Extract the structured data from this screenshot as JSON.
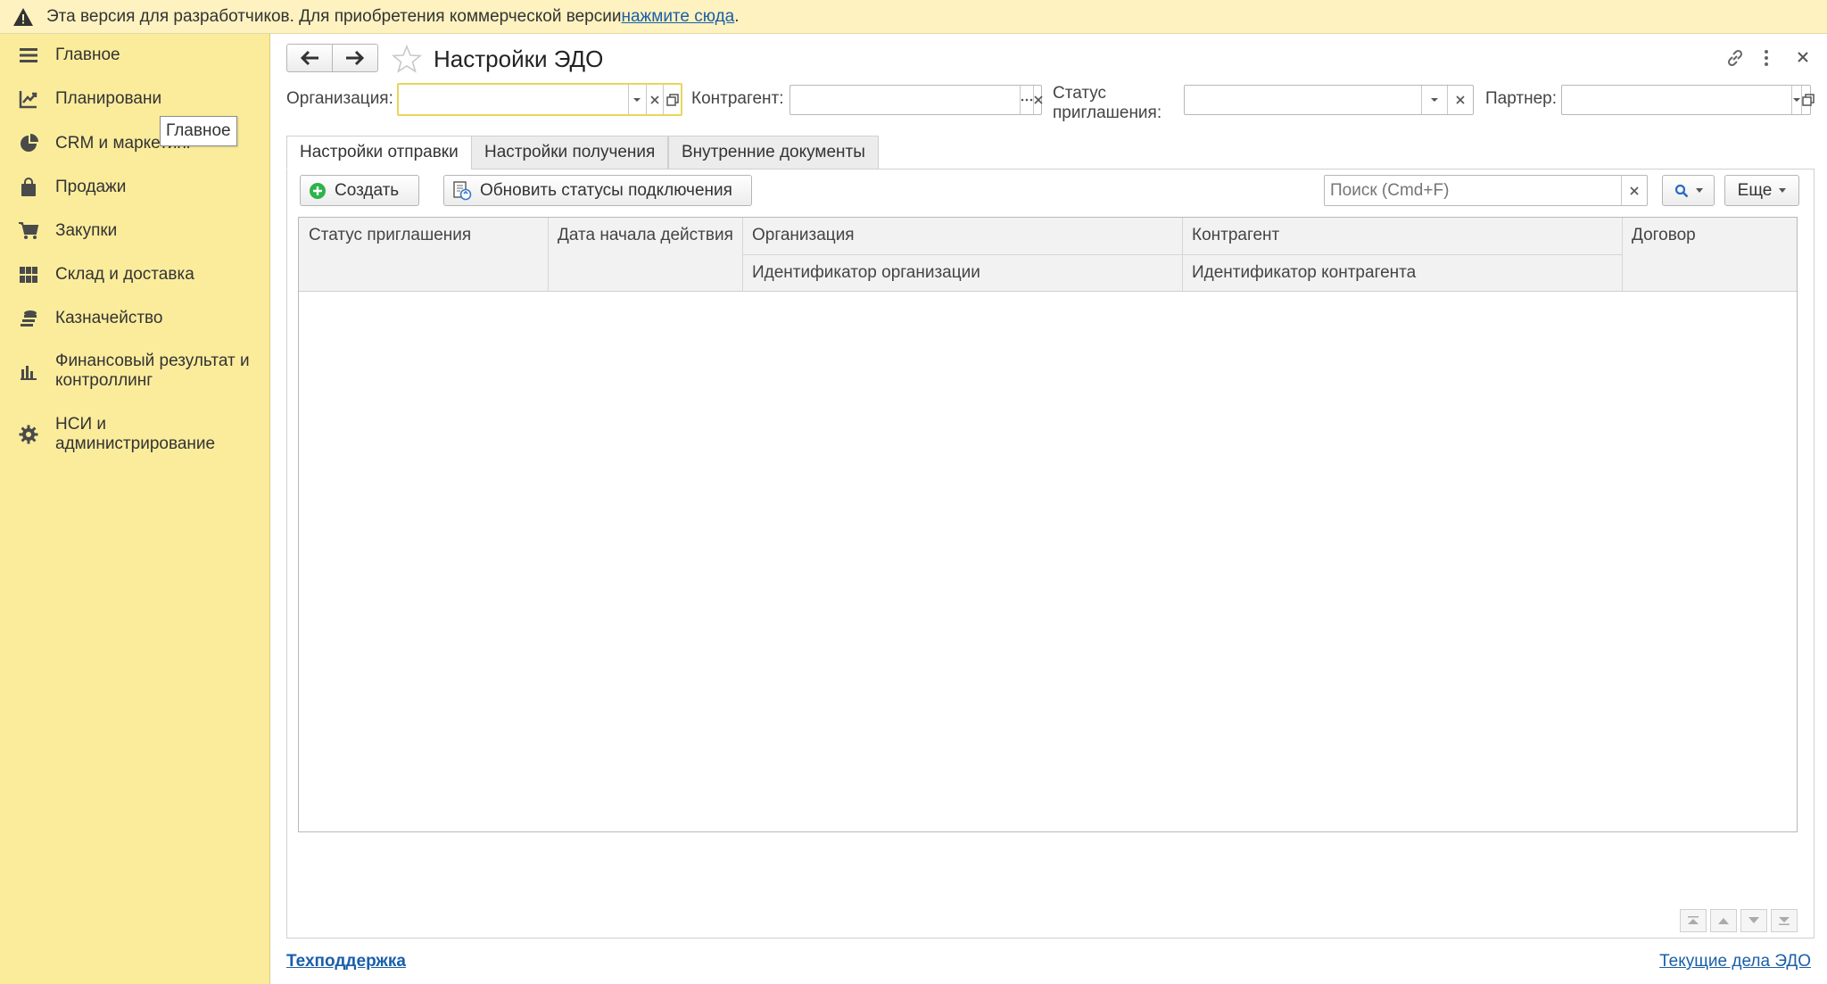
{
  "banner": {
    "text": "Эта версия для разработчиков. Для приобретения коммерческой версии ",
    "link": "нажмите сюда",
    "suffix": "."
  },
  "sidebar": {
    "items": [
      {
        "label": "Главное",
        "icon": "menu-icon"
      },
      {
        "label": "Планировани",
        "icon": "planning-icon"
      },
      {
        "label": "CRM и маркетинг",
        "icon": "pie-chart-icon"
      },
      {
        "label": "Продажи",
        "icon": "bag-icon"
      },
      {
        "label": "Закупки",
        "icon": "cart-icon"
      },
      {
        "label": "Склад и доставка",
        "icon": "grid-icon"
      },
      {
        "label": "Казначейство",
        "icon": "coins-icon"
      },
      {
        "label": "Финансовый результат и контроллинг",
        "icon": "bar-chart-icon"
      },
      {
        "label": "НСИ и администрирование",
        "icon": "gear-icon"
      }
    ],
    "tooltip": "Главное"
  },
  "header": {
    "title": "Настройки ЭДО"
  },
  "filters": {
    "org_label": "Организация:",
    "org_value": "",
    "counterparty_label": "Контрагент:",
    "counterparty_value": "",
    "status_label": "Статус приглашения:",
    "status_value": "",
    "partner_label": "Партнер:",
    "partner_value": ""
  },
  "tabs": [
    {
      "label": "Настройки отправки",
      "active": true
    },
    {
      "label": "Настройки получения",
      "active": false
    },
    {
      "label": "Внутренние документы",
      "active": false
    }
  ],
  "toolbar": {
    "create_label": "Создать",
    "refresh_label": "Обновить статусы подключения",
    "search_placeholder": "Поиск (Cmd+F)",
    "more_label": "Еще"
  },
  "table": {
    "columns": {
      "status": "Статус приглашения",
      "date": "Дата начала действия",
      "org": "Организация",
      "org_id": "Идентификатор организации",
      "counterparty": "Контрагент",
      "counterparty_id": "Идентификатор контрагента",
      "contract": "Договор"
    },
    "rows": []
  },
  "footer": {
    "support": "Техподдержка",
    "current_tasks": "Текущие дела ЭДО"
  },
  "colors": {
    "sidebar": "#fbec9c",
    "banner": "#fdf2c0",
    "link": "#1a5fa9",
    "accent_green": "#2db34a"
  }
}
